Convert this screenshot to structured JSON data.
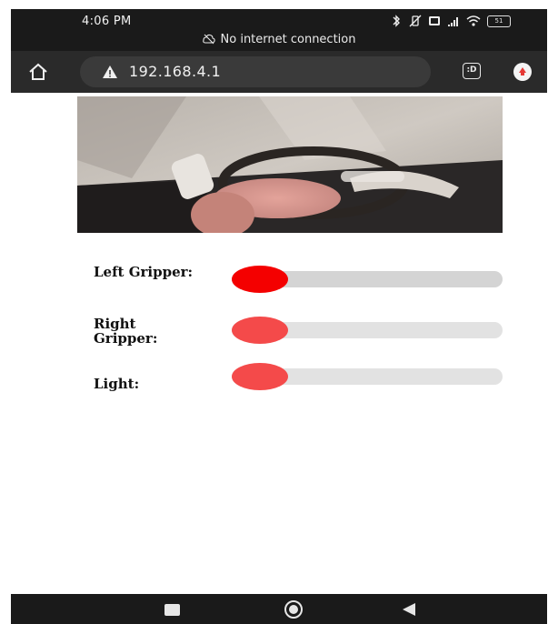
{
  "status_bar": {
    "time": "4:06 PM",
    "connection_notice": "No internet connection",
    "battery": "51",
    "icons": [
      "bluetooth-icon",
      "mute-vibrate-icon",
      "nfc-icon",
      "signal-icon",
      "wifi-icon",
      "battery-icon"
    ]
  },
  "browser": {
    "url": "192.168.4.1",
    "tabs_label": ":D",
    "icons": [
      "home-icon",
      "warning-icon",
      "tabs-icon",
      "menu-icon"
    ]
  },
  "camera": {
    "icon": "camera-stream-image"
  },
  "controls": [
    {
      "label": "Left Gripper:",
      "value": 0,
      "track_color": "#d4d4d4",
      "thumb_color": "#f40000"
    },
    {
      "label": "Right Gripper:",
      "value": 0,
      "track_color": "#e2e2e2",
      "thumb_color": "#f44a4a"
    },
    {
      "label": "Light:",
      "value": 0,
      "track_color": "#e2e2e2",
      "thumb_color": "#f44a4a"
    }
  ],
  "nav_bar": {
    "icons": [
      "recent-apps-icon",
      "home-circle-icon",
      "back-icon"
    ]
  },
  "colors": {
    "status_bar_bg": "#1a1a1a",
    "toolbar_bg": "#2a2a2a",
    "urlbar_bg": "#3a3a3a",
    "accent_red": "#f40000"
  }
}
